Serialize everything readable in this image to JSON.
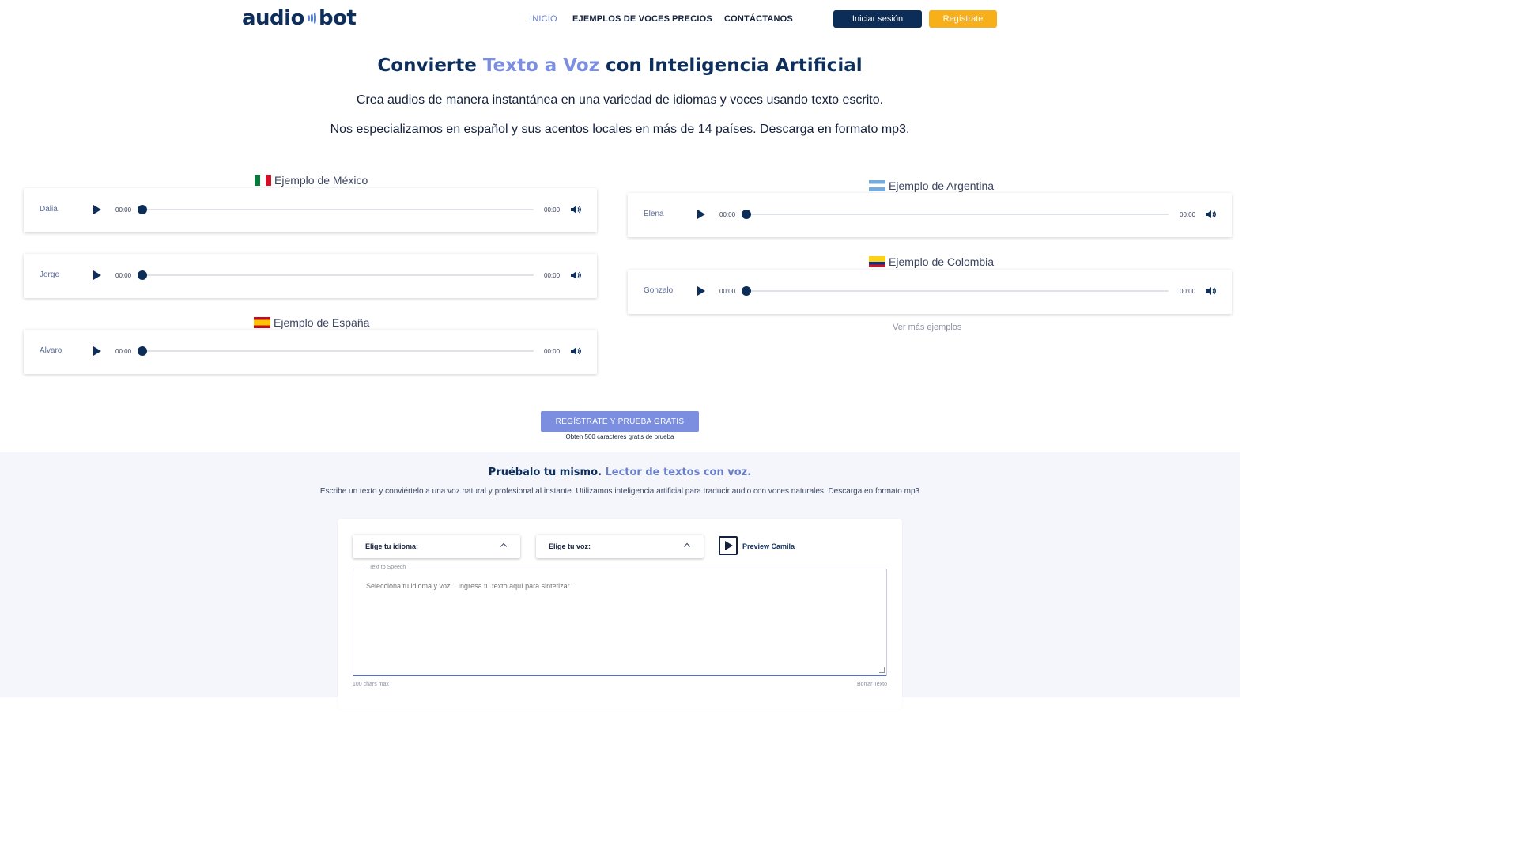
{
  "header": {
    "logo_left": "audio",
    "logo_right": "bot",
    "nav": [
      {
        "label": "INICIO"
      },
      {
        "label": "EJEMPLOS DE VOCES"
      },
      {
        "label": "PRECIOS"
      },
      {
        "label": "CONTÁCTANOS"
      }
    ],
    "login_label": "Iniciar sesión",
    "register_label": "Regístrate"
  },
  "hero": {
    "title_before": "Convierte ",
    "title_accent": "Texto a Voz",
    "title_after": " con Inteligencia Artificial",
    "subtitle_1": "Crea audios de manera instantánea en una variedad de idiomas y voces usando texto escrito.",
    "subtitle_2": "Nos especializamos en español y sus acentos locales en más de 14 países. Descarga en formato mp3."
  },
  "examples": {
    "mexico": "Ejemplo de México",
    "espana": "Ejemplo de España",
    "argentina": "Ejemplo de Argentina",
    "colombia": "Ejemplo de Colombia",
    "more_link": "Ver más ejemplos",
    "players": [
      {
        "name": "Dalia",
        "current": "00:00",
        "duration": "00:00",
        "progress": 0
      },
      {
        "name": "Jorge",
        "current": "00:00",
        "duration": "00:00",
        "progress": 0
      },
      {
        "name": "Alvaro",
        "current": "00:00",
        "duration": "00:00",
        "progress": 0
      },
      {
        "name": "Elena",
        "current": "00:00",
        "duration": "00:00",
        "progress": 0
      },
      {
        "name": "Gonzalo",
        "current": "00:00",
        "duration": "00:00",
        "progress": 0
      }
    ]
  },
  "cta": {
    "label": "REGÍSTRATE Y PRUEBA GRATIS",
    "note": "Obten 500 caracteres gratis de prueba"
  },
  "try": {
    "title_bold": "Pruébalo tu mismo. ",
    "title_accent": "Lector de textos con voz.",
    "description": "Escribe un texto y conviértelo a una voz natural y profesional al instante. Utilizamos inteligencia artificial para traducir audio con voces naturales. Descarga en formato mp3",
    "language_label": "Elige tu idioma:",
    "voice_label": "Elige tu voz:",
    "preview_label": "Preview Camila",
    "legend": "Text to Speech",
    "placeholder": "Selecciona tu idioma y voz... Ingresa tu texto aquí para sintetizar...",
    "chars_max": "100 chars max",
    "clear_label": "Borrar Texto"
  },
  "colors": {
    "brand_dark": "#0e2f5c",
    "accent": "#7b8ee0",
    "register": "#f7b019"
  }
}
